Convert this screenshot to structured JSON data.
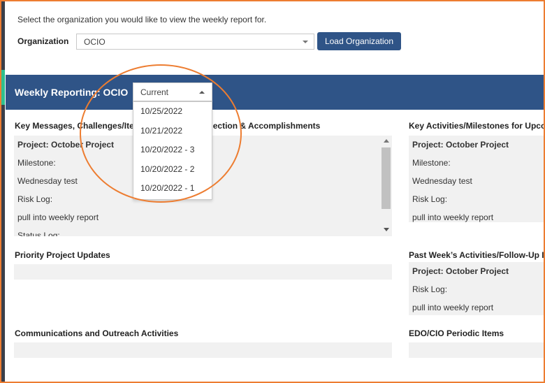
{
  "instruction": "Select the organization you would like to view the weekly report for.",
  "organization": {
    "label": "Organization",
    "selected": "OCIO",
    "load_button": "Load Organization"
  },
  "banner": {
    "title": "Weekly Reporting: OCIO",
    "report_select": {
      "selected": "Current",
      "options": [
        "10/25/2022",
        "10/21/2022",
        "10/20/2022 - 3",
        "10/20/2022 - 2",
        "10/20/2022 - 1"
      ]
    }
  },
  "sections": {
    "key_messages": {
      "title": "Key Messages, Challenges/Ite",
      "title_tail": "ection & Accomplishments",
      "lines": [
        "Project: October Project",
        "Milestone:",
        "Wednesday test",
        "Risk Log:",
        "pull into weekly report",
        "Status Log:"
      ]
    },
    "key_activities": {
      "title": "Key Activities/Milestones for Upco",
      "lines": [
        "Project: October Project",
        "Milestone:",
        "Wednesday test",
        "Risk Log:",
        "pull into weekly report"
      ]
    },
    "priority_updates": {
      "title": "Priority Project Updates"
    },
    "past_week": {
      "title": "Past Week’s Activities/Follow-Up I",
      "lines": [
        "Project: October Project",
        "Risk Log:",
        "pull into weekly report"
      ]
    },
    "communications": {
      "title": "Communications and Outreach Activities"
    },
    "edo_cio": {
      "title": "EDO/CIO Periodic Items"
    }
  },
  "colors": {
    "banner": "#2f5487",
    "highlight": "#ed7d31",
    "panel": "#f1f1f1"
  }
}
